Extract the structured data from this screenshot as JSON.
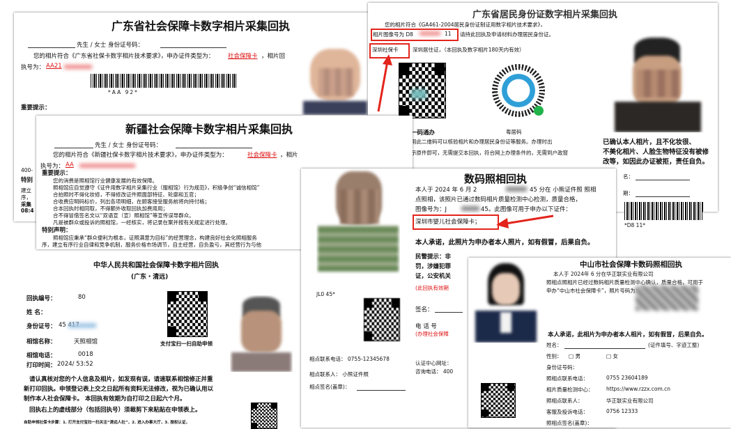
{
  "docs": {
    "guangdong": {
      "title": "广东省社会保障卡数字相片采集回执",
      "line1": "先生 / 女士 身份证号码：",
      "line2a": "您的相片符合《广东省社保卡数字相片技术要求》，申办证件类型为：",
      "line2b": "社会保障卡",
      "line2c": "，相片回",
      "line3": "执号为：",
      "line3_value": "AA21",
      "barcode_text": "*AA           92*",
      "important": "重要提示：",
      "side_a": "400-",
      "side_b": "特别",
      "side_c": "建立",
      "side_d": "序，",
      "side_e": "采集",
      "side_f": "08:4"
    },
    "xinjiang": {
      "title": "新疆社会保障卡数字相片采集回执",
      "line1": "先生 / 女士 身份证号码：",
      "line2a": "您的相片符合《新疆社保卡数字相片技术要求》，申办证件类型为：",
      "line2b": "社会保障卡",
      "line2c": "，相片",
      "line3": "执号为：",
      "line3_value": "AA",
      "important": "重要提示：",
      "tips": [
        "您的消费是照相馆行业健康发展的有效保障。",
        "照相馆应自觉遵守《证件用数字相片采集行业（服相馆）行为规范》，积极争创“诚信相馆”",
        "合拍照时不得化妆修，不得修改证件照面部特征、轮廓和五官；",
        "合收费应明码标价，列出各项明细，在顾客接受服务前将向持付格；",
        "合本回执时相同取，不得额外收取回执加费用用；",
        "合不得冒借签名文以“双语宣（宣）照相馆”等宣传误导群众。",
        "凡是被群众或投诉的照相馆，一经核实，将记录在案并按有关规定进行处理。"
      ],
      "special": "特别声明：",
      "special_text": "照相馆应秉承“群众便利为根本，证照满意为目标”的经营理念，构建良好社会化照相服务",
      "special_text2": "序，建立有序行业自律和竞争机制，服务价格市场调节，自主经营，自负盈亏，其经营行为与他"
    },
    "resident": {
      "title": "广东省居民身份证数字相片采集回执",
      "line1": "您的相片符合《GA461-2004居民身份证制证用数字相片技术要求》，",
      "line2a": "相片图像号为 D8",
      "line2b": "11",
      "line2c": "请持此回执及申请材料办理居民身份证。",
      "line3a": "深圳社保卡",
      "line3b": "深圳居住证，（本回执及数字相片180天内有效）",
      "qr1_label": "一码通办",
      "qr2_label": "粤居码",
      "para1": "用此二维码可以核验相片和办理居民身份证等服务。办理时出",
      "para2": "示原件即可，无需提交本回执，符合网上办理条件的，无需到户政窗",
      "warn1": "已确认本人相片，且不化妆很、",
      "warn2": "不美化相片、人脸生物特征没有被修",
      "warn3": "改等，如因此办证被拒，责任自负。",
      "sig1": "名：",
      "sig2": "期：",
      "barcode_text": "*D8            11*"
    },
    "digital": {
      "title": "数码照相回执",
      "p1a": "本人于 2024 年 6 月 2",
      "p1b": "45 分在 小熊证件照 照相",
      "p2": "点照相，该照片已通过数码相片质量检测中心检测，质量合格，",
      "p3a": "图像号为：J",
      "p3b": "45。此图像可用于申办以下证件：",
      "boxed": "深圳市婴儿社会保障卡；",
      "promise": "本人承诺，此照片为申办者本人照片，如有假冒，后果自负。",
      "hint1": "民警提示：非",
      "hint2": "罚，涉嫌犯罪",
      "hint3": "证，公安机关",
      "hint4": "(此回执有效期",
      "sign": "签名：",
      "phone_label": "电  话  号",
      "phone_note": "(办理社会保障",
      "contact_phone": "相点联系电话：   0755-12345678",
      "contact_person": "相点联系人：   小熊证件照",
      "stamp": "相点签名(盖章)：",
      "verify1": "认证中心网址：",
      "verify2": "咨询电话：  400",
      "code": "JL0            45*"
    },
    "qingyuan": {
      "title": "中华人民共和国社会保障卡数字相片回执",
      "subtitle": "(广东・清远)",
      "fields": [
        {
          "label": "回执编号：",
          "value": "80"
        },
        {
          "label": "姓    名：",
          "value": ""
        },
        {
          "label": "身份证号：",
          "value": "45           417"
        },
        {
          "label": "相馆名称：",
          "value": "天照相馆"
        },
        {
          "label": "相馆电话：",
          "value": "0018"
        },
        {
          "label": "打印时间：",
          "value": "2024/       53:52"
        }
      ],
      "qr_label": "支付宝扫一扫自助申领",
      "notice1": "请认真核对您的个人信息及相片，如发现有误，请速联系相馆修正并重",
      "notice2": "新打印回执。申领登记表上交之日起所有资料无法修改，视为已确认用以",
      "notice3": "制作本人社会保障卡。 本回执有效期为自打印之日起六个月。",
      "notice4": "回执右上的虚线部分（包括回执号）须裁剪下来粘贴在申领表上。",
      "footer": "自助申领社保卡步骤：1. 打开支付宝扫一扫关注“清远人社”，2. 进入办事大厅，3. 授权认证，"
    },
    "zhongshan": {
      "title": "中山市社会保障卡数码照相回执",
      "p1": "本人于 2024年 6          分在华正联实业有限公司",
      "p2": "照相点照相片已经过数码相片质量检测中心确认，质量合格，可用于",
      "p3": "申办“中山市社会保障卡”，照片号码为：",
      "promise": "本人承诺，此相片为申办者本人相片，如有假冒，后果自负。",
      "name_label": "姓名：",
      "name_hint": "(证件填号、字迹工整)",
      "gender_label": "性别：",
      "gender_m": "□ 男",
      "gender_f": "□ 女",
      "id_label": "身份证号码：",
      "rows": [
        {
          "label": "照相点联系电话：",
          "value": "0755 23604189"
        },
        {
          "label": "相片质量检测中心：",
          "value": "https://www.rzzx.com.cn"
        },
        {
          "label": "照相点联系人：",
          "value": "华正联实业有限公司"
        },
        {
          "label": "客服及投诉电话：",
          "value": "0756 12333"
        },
        {
          "label": "照相点签名(盖章)：",
          "value": ""
        }
      ]
    }
  },
  "colors": {
    "annotation_red": "#e3241b",
    "link_red": "#d11111"
  }
}
